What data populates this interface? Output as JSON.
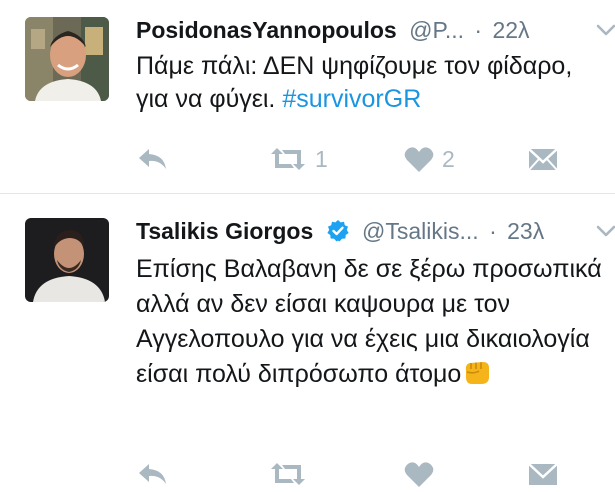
{
  "tweets": [
    {
      "name": "PosidonasYannopoulos",
      "handle": "@P...",
      "separator": "·",
      "time": "22λ",
      "text_main": "Πάμε πάλι: ΔΕΝ ψηφίζουμε τον φίδαρο, για να φύγει.",
      "hashtag": "#survivorGR",
      "retweets": "1",
      "likes": "2",
      "verified": false
    },
    {
      "name": "Tsalikis Giorgos",
      "handle": "@Tsalikis...",
      "separator": "·",
      "time": "23λ",
      "text_main": "Επίσης Βαλαβανη δε σε ξέρω προσωπικά αλλά αν δεν είσαι καψουρα με τον Αγγελοπουλο για να έχεις μια δικαιολογία είσαι πολύ διπρόσωπο άτομο",
      "emoji": "fist-emoji",
      "verified": true
    }
  ],
  "colors": {
    "text": "#14171a",
    "secondary": "#657786",
    "action_icon": "#aab8c2",
    "link": "#1b95e0",
    "verified": "#1da1f2",
    "divider": "#e1e8ed"
  },
  "icons": [
    "reply-icon",
    "retweet-icon",
    "like-icon",
    "direct-message-icon",
    "chevron-down-icon",
    "verified-badge-icon"
  ]
}
